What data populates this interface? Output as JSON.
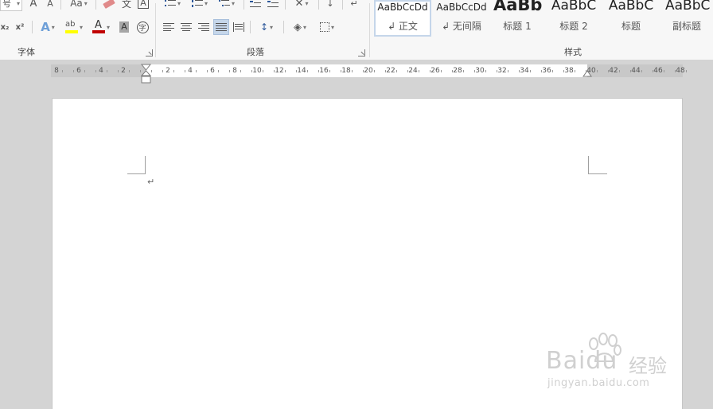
{
  "ribbon": {
    "font_group": {
      "label": "字体",
      "size_box_text": "号",
      "grow_font": "A",
      "shrink_font": "A",
      "change_case": "Aa",
      "subscript": "x₂",
      "superscript": "x²",
      "text_effects": "A",
      "highlight": "ab",
      "font_color": "A",
      "char_shading": "A",
      "enclose_char": "字",
      "phonetic": "文",
      "char_border": "A"
    },
    "paragraph_group": {
      "label": "段落"
    },
    "styles_group": {
      "label": "样式",
      "items": [
        {
          "sample": "AaBbCcDd",
          "name": "↲ 正文",
          "selected": true
        },
        {
          "sample": "AaBbCcDd",
          "name": "↲ 无间隔",
          "selected": false
        },
        {
          "sample": "AaBb",
          "name": "标题 1",
          "selected": false
        },
        {
          "sample": "AaBbC",
          "name": "标题 2",
          "selected": false
        },
        {
          "sample": "AaBbC",
          "name": "标题",
          "selected": false
        },
        {
          "sample": "AaBbC",
          "name": "副标题",
          "selected": false
        }
      ]
    }
  },
  "ruler": {
    "left_numbers": [
      "8",
      "6",
      "4",
      "2"
    ],
    "right_numbers": [
      "2",
      "4",
      "6",
      "8",
      "10",
      "12",
      "14",
      "16",
      "18",
      "20",
      "22",
      "24",
      "26",
      "28",
      "30",
      "32",
      "34",
      "36",
      "38",
      "40",
      "42",
      "44",
      "46",
      "48"
    ]
  },
  "document": {
    "paragraph_mark": "↵"
  },
  "watermark": {
    "brand": "Baidu",
    "brand_cn": "经验",
    "url": "jingyan.baidu.com"
  },
  "colors": {
    "highlight_yellow": "#ffff00",
    "font_color_red": "#c00000",
    "accent_blue": "#c5d6ea"
  }
}
